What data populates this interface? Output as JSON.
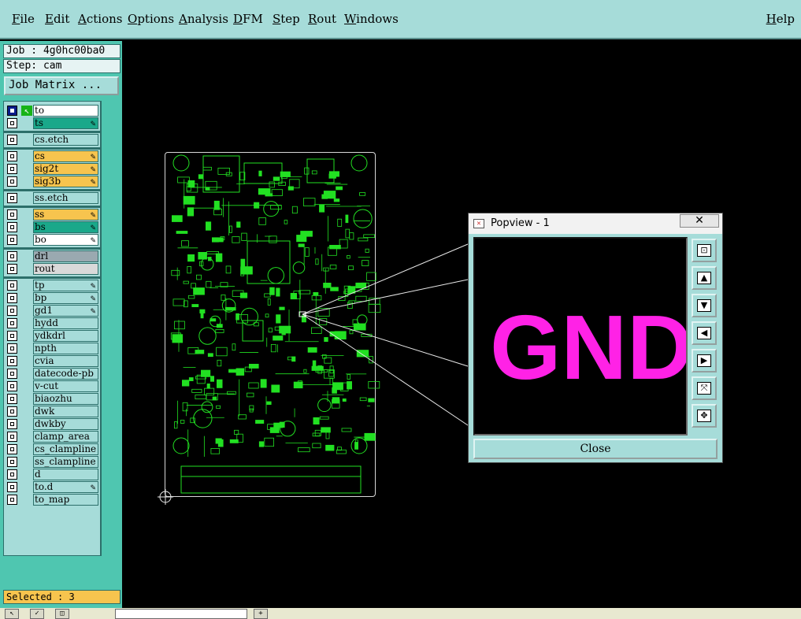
{
  "menu": {
    "items": [
      "File",
      "Edit",
      "Actions",
      "Options",
      "Analysis",
      "DFM",
      "Step",
      "Rout",
      "Windows"
    ],
    "help": "Help"
  },
  "job": {
    "job_label": "Job : 4g0hc00ba0",
    "step_label": "Step: cam",
    "matrix_button": "Job Matrix ..."
  },
  "layers": [
    {
      "name": "to",
      "color": "#ffffff",
      "checked": true,
      "active": true
    },
    {
      "name": "ts",
      "color": "#1aa88a",
      "tick": true
    },
    {
      "name": "cs.etch",
      "color": "#a6dcd9"
    },
    {
      "name": "cs",
      "color": "#f7c44e",
      "tick": true
    },
    {
      "name": "sig2t",
      "color": "#f7c44e",
      "tick": true
    },
    {
      "name": "sig3b",
      "color": "#f7c44e",
      "tick": true
    },
    {
      "name": "ss.etch",
      "color": "#a6dcd9"
    },
    {
      "name": "ss",
      "color": "#f7c44e",
      "tick": true
    },
    {
      "name": "bs",
      "color": "#1aa88a",
      "tick": true
    },
    {
      "name": "bo",
      "color": "#ffffff",
      "tick": true
    },
    {
      "name": "drl",
      "color": "#9aa9b0"
    },
    {
      "name": "rout",
      "color": "#d9d9d9"
    },
    {
      "name": "tp",
      "color": "#a6dcd9",
      "tick": true
    },
    {
      "name": "bp",
      "color": "#a6dcd9",
      "tick": true
    },
    {
      "name": "gd1",
      "color": "#a6dcd9",
      "tick": true
    },
    {
      "name": "hydd",
      "color": "#a6dcd9"
    },
    {
      "name": "ydkdrl",
      "color": "#a6dcd9"
    },
    {
      "name": "npth",
      "color": "#a6dcd9"
    },
    {
      "name": "cvia",
      "color": "#a6dcd9"
    },
    {
      "name": "datecode-pb",
      "color": "#a6dcd9"
    },
    {
      "name": "v-cut",
      "color": "#a6dcd9"
    },
    {
      "name": "biaozhu",
      "color": "#a6dcd9"
    },
    {
      "name": "dwk",
      "color": "#a6dcd9"
    },
    {
      "name": "dwkby",
      "color": "#a6dcd9"
    },
    {
      "name": "clamp_area",
      "color": "#a6dcd9"
    },
    {
      "name": "cs_clampline",
      "color": "#a6dcd9"
    },
    {
      "name": "ss_clampline",
      "color": "#a6dcd9"
    },
    {
      "name": "d",
      "color": "#a6dcd9"
    },
    {
      "name": "to.d",
      "color": "#a6dcd9",
      "tick": true
    },
    {
      "name": "to_map",
      "color": "#a6dcd9"
    }
  ],
  "status": {
    "selected": "Selected : 3"
  },
  "popview": {
    "title": "Popview - 1",
    "close_x": "✕",
    "content_text": "GND",
    "content_color": "#ff22e6",
    "close_button": "Close",
    "tools": [
      "zoom-fit-icon",
      "pan-up-icon",
      "pan-down-icon",
      "pan-left-icon",
      "pan-right-icon",
      "zoom-out-icon",
      "zoom-in-icon"
    ]
  },
  "colors": {
    "trace": "#22e022",
    "board_outline": "#d8d8d8",
    "panel_bg": "#4fc6b0",
    "menu_bg": "#a6dcd9"
  }
}
